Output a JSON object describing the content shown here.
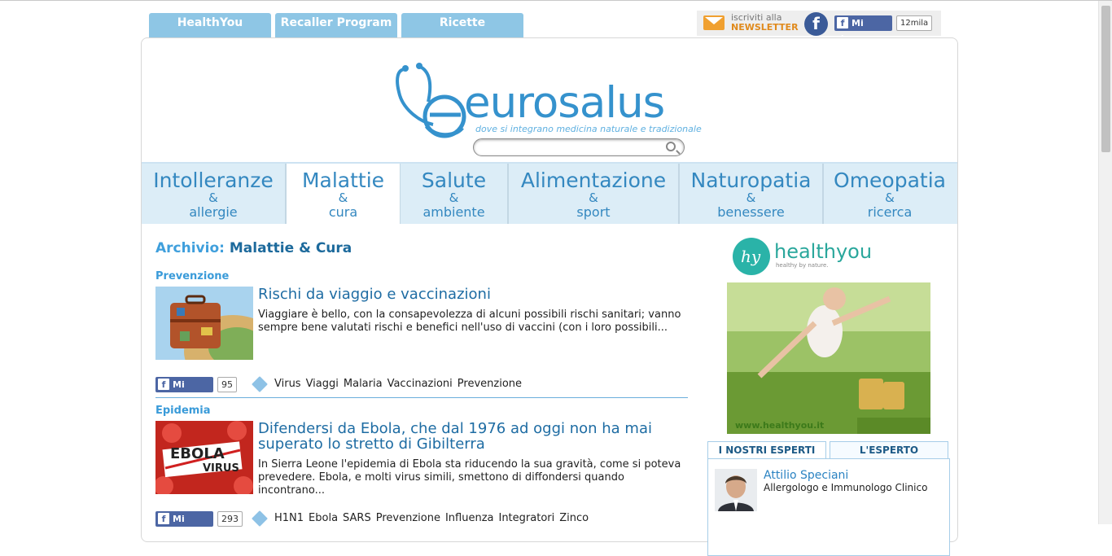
{
  "top_tabs": [
    "HealthYou",
    "Recaller Program",
    "Ricette"
  ],
  "newsletter": {
    "line1": "iscriviti alla",
    "line2": "NEWSLETTER"
  },
  "facebook": {
    "like_label": "Mi piace",
    "count": "12mila"
  },
  "logo": {
    "name": "eurosalus",
    "tagline": "dove si integrano medicina naturale e tradizionale"
  },
  "search": {
    "placeholder": ""
  },
  "nav": [
    {
      "title": "Intolleranze",
      "amp": "&",
      "sub": "allergie"
    },
    {
      "title": "Malattie",
      "amp": "&",
      "sub": "cura"
    },
    {
      "title": "Salute",
      "amp": "&",
      "sub": "ambiente"
    },
    {
      "title": "Alimentazione",
      "amp": "&",
      "sub": "sport"
    },
    {
      "title": "Naturopatia",
      "amp": "&",
      "sub": "benessere"
    },
    {
      "title": "Omeopatia",
      "amp": "&",
      "sub": "ricerca"
    }
  ],
  "archive": {
    "prefix": "Archivio:",
    "name": "Malattie & Cura"
  },
  "articles": [
    {
      "category": "Prevenzione",
      "title": "Rischi da viaggio e vaccinazioni",
      "excerpt": "Viaggiare è bello, con la consapevolezza di alcuni possibili rischi sanitari; vanno sempre bene valutati rischi e benefici nell'uso di vaccini (con i loro possibili...",
      "likes": "95",
      "tags": [
        "Virus",
        "Viaggi",
        "Malaria",
        "Vaccinazioni",
        "Prevenzione"
      ]
    },
    {
      "category": "Epidemia",
      "title": "Difendersi da Ebola, che dal 1976 ad oggi non ha mai superato lo stretto di Gibilterra",
      "excerpt": "In Sierra Leone l'epidemia di Ebola sta riducendo la sua gravità, come si poteva prevedere. Ebola, e molti virus simili, smettono di diffondersi quando incontrano...",
      "likes": "293",
      "tags": [
        "H1N1",
        "Ebola",
        "SARS",
        "Prevenzione",
        "Influenza",
        "Integratori",
        "Zinco"
      ],
      "image_text": {
        "line1": "EBOLA",
        "line2": "VIRUS"
      }
    }
  ],
  "banner": {
    "brand": "healthyou",
    "logo_letters": "hy",
    "tagline": "healthy by nature.",
    "url": "www.healthyou.it"
  },
  "experts": {
    "tabs": [
      "I NOSTRI ESPERTI",
      "L'ESPERTO RISPONDE"
    ],
    "name": "Attilio Speciani",
    "role": "Allergologo e Immunologo Clinico"
  },
  "colors": {
    "accent": "#3488c0",
    "tab": "#8ec6e5",
    "nav_bg": "#dcedf7",
    "fb": "#4c66a4"
  }
}
